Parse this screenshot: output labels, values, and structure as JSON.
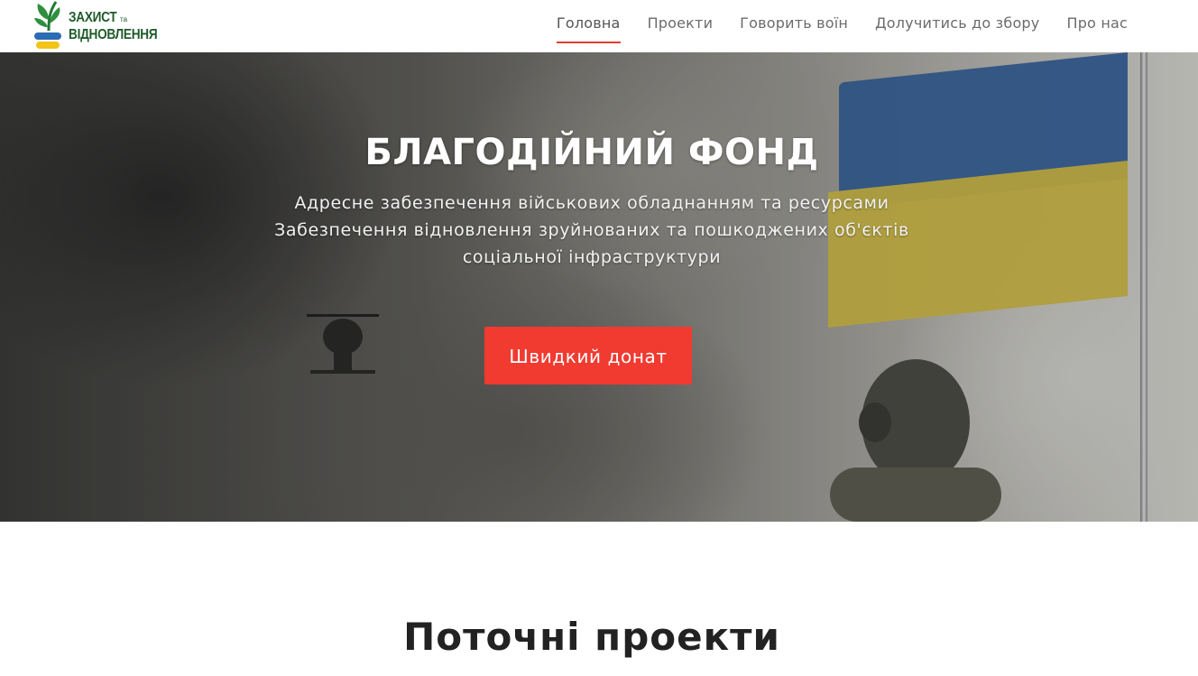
{
  "header": {
    "logo": {
      "line1": "ЗАХИСТ",
      "ta": "та",
      "line2": "ВІДНОВЛЕННЯ"
    },
    "nav": [
      {
        "label": "Головна",
        "active": true
      },
      {
        "label": "Проекти",
        "active": false
      },
      {
        "label": "Говорить воїн",
        "active": false
      },
      {
        "label": "Долучитись до збору",
        "active": false
      },
      {
        "label": "Про нас",
        "active": false
      }
    ]
  },
  "hero": {
    "title": "БЛАГОДІЙНИЙ ФОНД",
    "subtitle_lines": [
      "Адресне забезпечення військових обладнанням та ресурсами",
      "Забезпечення відновлення зруйнованих та пошкоджених об'єктів",
      "соціальної інфраструктури"
    ],
    "donate_label": "Швидкий донат"
  },
  "section": {
    "title": "Поточні проекти"
  },
  "colors": {
    "accent": "#f13a30",
    "nav_active_underline": "#e33b2f",
    "logo_green": "#1f5a2b",
    "flag_blue": "#365f96",
    "flag_yellow": "#c9b547"
  }
}
